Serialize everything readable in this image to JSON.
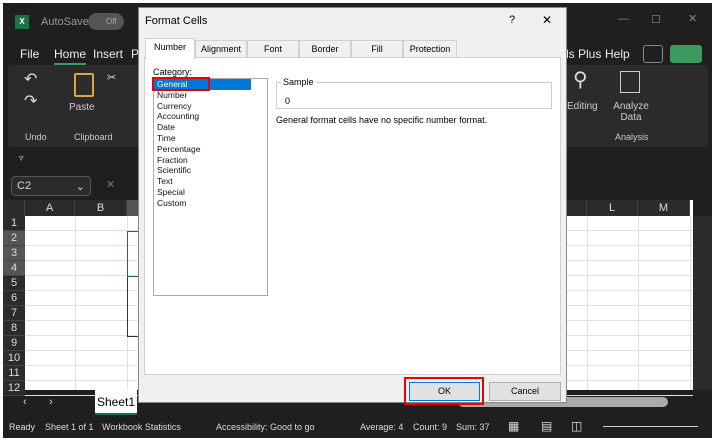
{
  "titlebar": {
    "autosave_label": "AutoSave",
    "toggle_state": "Off"
  },
  "ribbon_tabs": [
    "File",
    "Home",
    "Insert",
    "P",
    "ls Plus",
    "Help"
  ],
  "ribbon": {
    "undo_group": "Undo",
    "paste": "Paste",
    "clipboard_group": "Clipboard",
    "editing": "Editing",
    "analyze_data": "Analyze Data",
    "analysis_group": "Analysis"
  },
  "formula_bar": {
    "name_box": "C2"
  },
  "columns": [
    "A",
    "B",
    "L",
    "M"
  ],
  "rows": [
    "1",
    "2",
    "3",
    "4",
    "5",
    "6",
    "7",
    "8",
    "9",
    "10",
    "11",
    "12"
  ],
  "sheet_tab": "Sheet1",
  "status": {
    "ready": "Ready",
    "sheet": "Sheet 1 of 1",
    "workbook_stats": "Workbook Statistics",
    "accessibility": "Accessibility: Good to go",
    "average": "Average: 4",
    "count": "Count: 9",
    "sum": "Sum: 37"
  },
  "dialog": {
    "title": "Format Cells",
    "help": "?",
    "close": "✕",
    "tabs": [
      "Number",
      "Alignment",
      "Font",
      "Border",
      "Fill",
      "Protection"
    ],
    "category_label": "Category:",
    "categories": [
      "General",
      "Number",
      "Currency",
      "Accounting",
      "Date",
      "Time",
      "Percentage",
      "Fraction",
      "Scientific",
      "Text",
      "Special",
      "Custom"
    ],
    "sample_label": "Sample",
    "sample_value": "0",
    "description": "General format cells have no specific number format.",
    "ok": "OK",
    "cancel": "Cancel"
  },
  "colors": {
    "accent": "#0078d7",
    "highlight": "#e00000",
    "excel_green": "#1e7145"
  }
}
